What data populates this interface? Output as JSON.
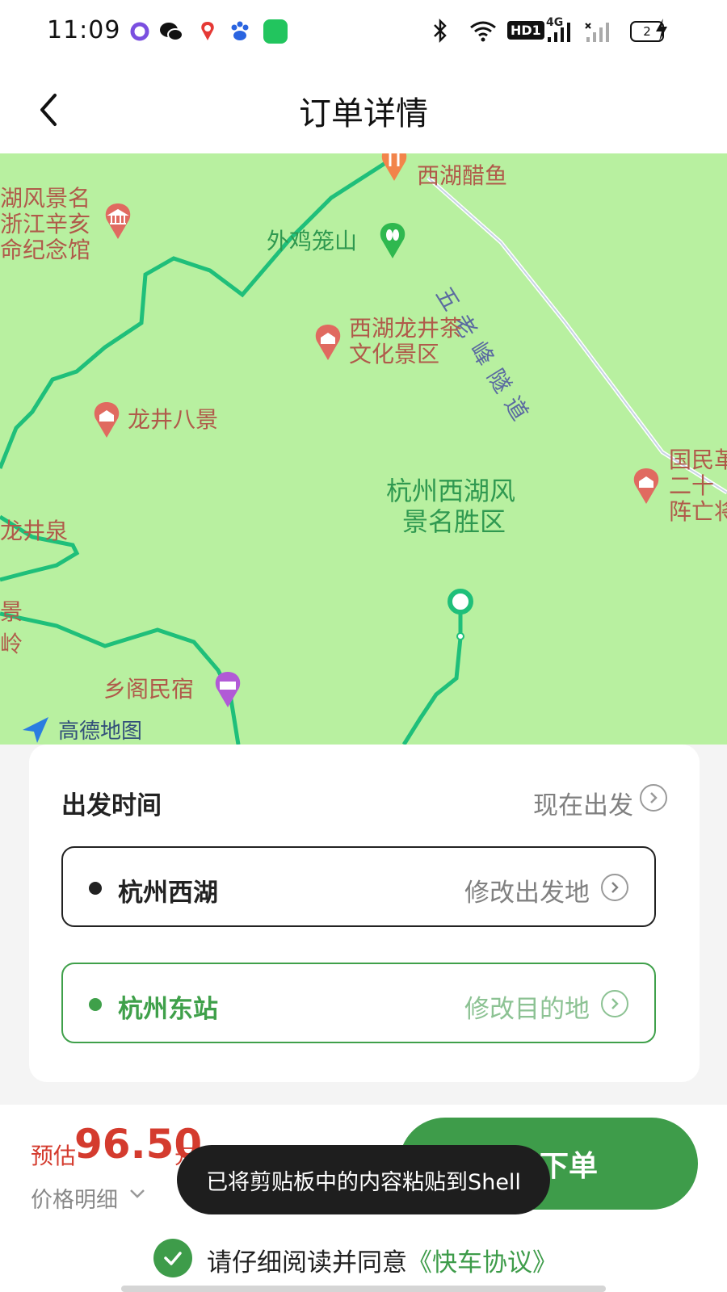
{
  "status_bar": {
    "time": "11:09",
    "network_badge": "HD1",
    "network_type": "4G",
    "battery_level": "2",
    "app_icons": [
      "circle-app-icon",
      "wechat-icon",
      "maps-pin-icon",
      "baidu-icon",
      "green-app-icon"
    ]
  },
  "header": {
    "title": "订单详情"
  },
  "map": {
    "labels": [
      "西湖醋鱼",
      "湖风景名",
      "浙江辛亥",
      "命纪念馆",
      "外鸡笼山",
      "五老峰隧道",
      "西湖龙井茶",
      "文化景区",
      "龙井八景",
      "杭州西湖风",
      "景名胜区",
      "国民革",
      "二十",
      "阵亡将",
      "龙井泉",
      "景",
      "岭",
      "乡阁民宿",
      "高德地图"
    ]
  },
  "trip": {
    "departure_label": "出发时间",
    "departure_value": "现在出发",
    "origin_name": "杭州西湖",
    "origin_action": "修改出发地",
    "destination_name": "杭州东站",
    "destination_action": "修改目的地"
  },
  "footer": {
    "estimate_label": "预估",
    "estimate_price": "96.50",
    "estimate_unit": "元",
    "price_detail": "价格明细",
    "order_button": "下单",
    "toast": "已将剪贴板中的内容粘贴到Shell",
    "agreement_text": "请仔细阅读并同意",
    "agreement_link": "《快车协议》"
  },
  "colors": {
    "accent_green": "#3e9c4a",
    "price_red": "#d43b2e",
    "map_green": "#b8f0a0",
    "route_green": "#1fbf7a"
  }
}
